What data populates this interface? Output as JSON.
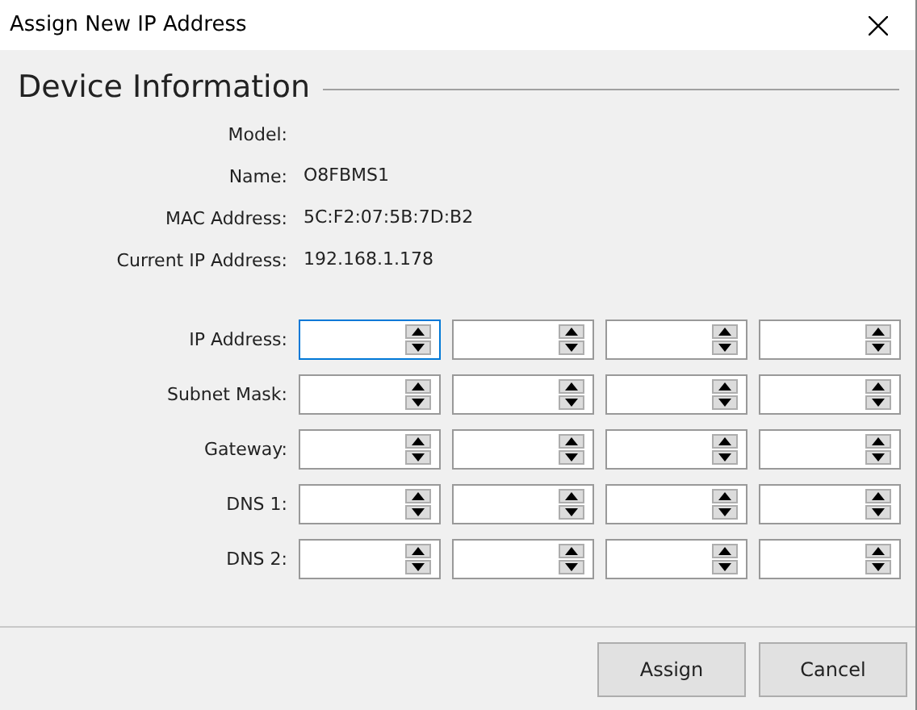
{
  "window": {
    "title": "Assign New IP Address"
  },
  "section": {
    "title": "Device Information"
  },
  "info": [
    {
      "label": "Model:"
    },
    {
      "label": "Name:",
      "value": "O8FBMS1"
    },
    {
      "label": "MAC Address:",
      "value": "5C:F2:07:5B:7D:B2"
    },
    {
      "label": "Current IP Address:",
      "value": "192.168.1.178"
    }
  ],
  "fields": [
    {
      "label": "IP Address:",
      "octets": [
        {
          "focused": true
        },
        {
          "focused": false
        },
        {
          "focused": false
        },
        {
          "focused": false
        }
      ]
    },
    {
      "label": "Subnet Mask:",
      "octets": [
        {
          "focused": false
        },
        {
          "focused": false
        },
        {
          "focused": false
        },
        {
          "focused": false
        }
      ]
    },
    {
      "label": "Gateway:",
      "octets": [
        {
          "focused": false
        },
        {
          "focused": false
        },
        {
          "focused": false
        },
        {
          "focused": false
        }
      ]
    },
    {
      "label": "DNS 1:",
      "octets": [
        {
          "focused": false
        },
        {
          "focused": false
        },
        {
          "focused": false
        },
        {
          "focused": false
        }
      ]
    },
    {
      "label": "DNS 2:",
      "octets": [
        {
          "focused": false
        },
        {
          "focused": false
        },
        {
          "focused": false
        },
        {
          "focused": false
        }
      ]
    }
  ],
  "buttons": [
    {
      "label": "Assign"
    },
    {
      "label": "Cancel"
    }
  ]
}
